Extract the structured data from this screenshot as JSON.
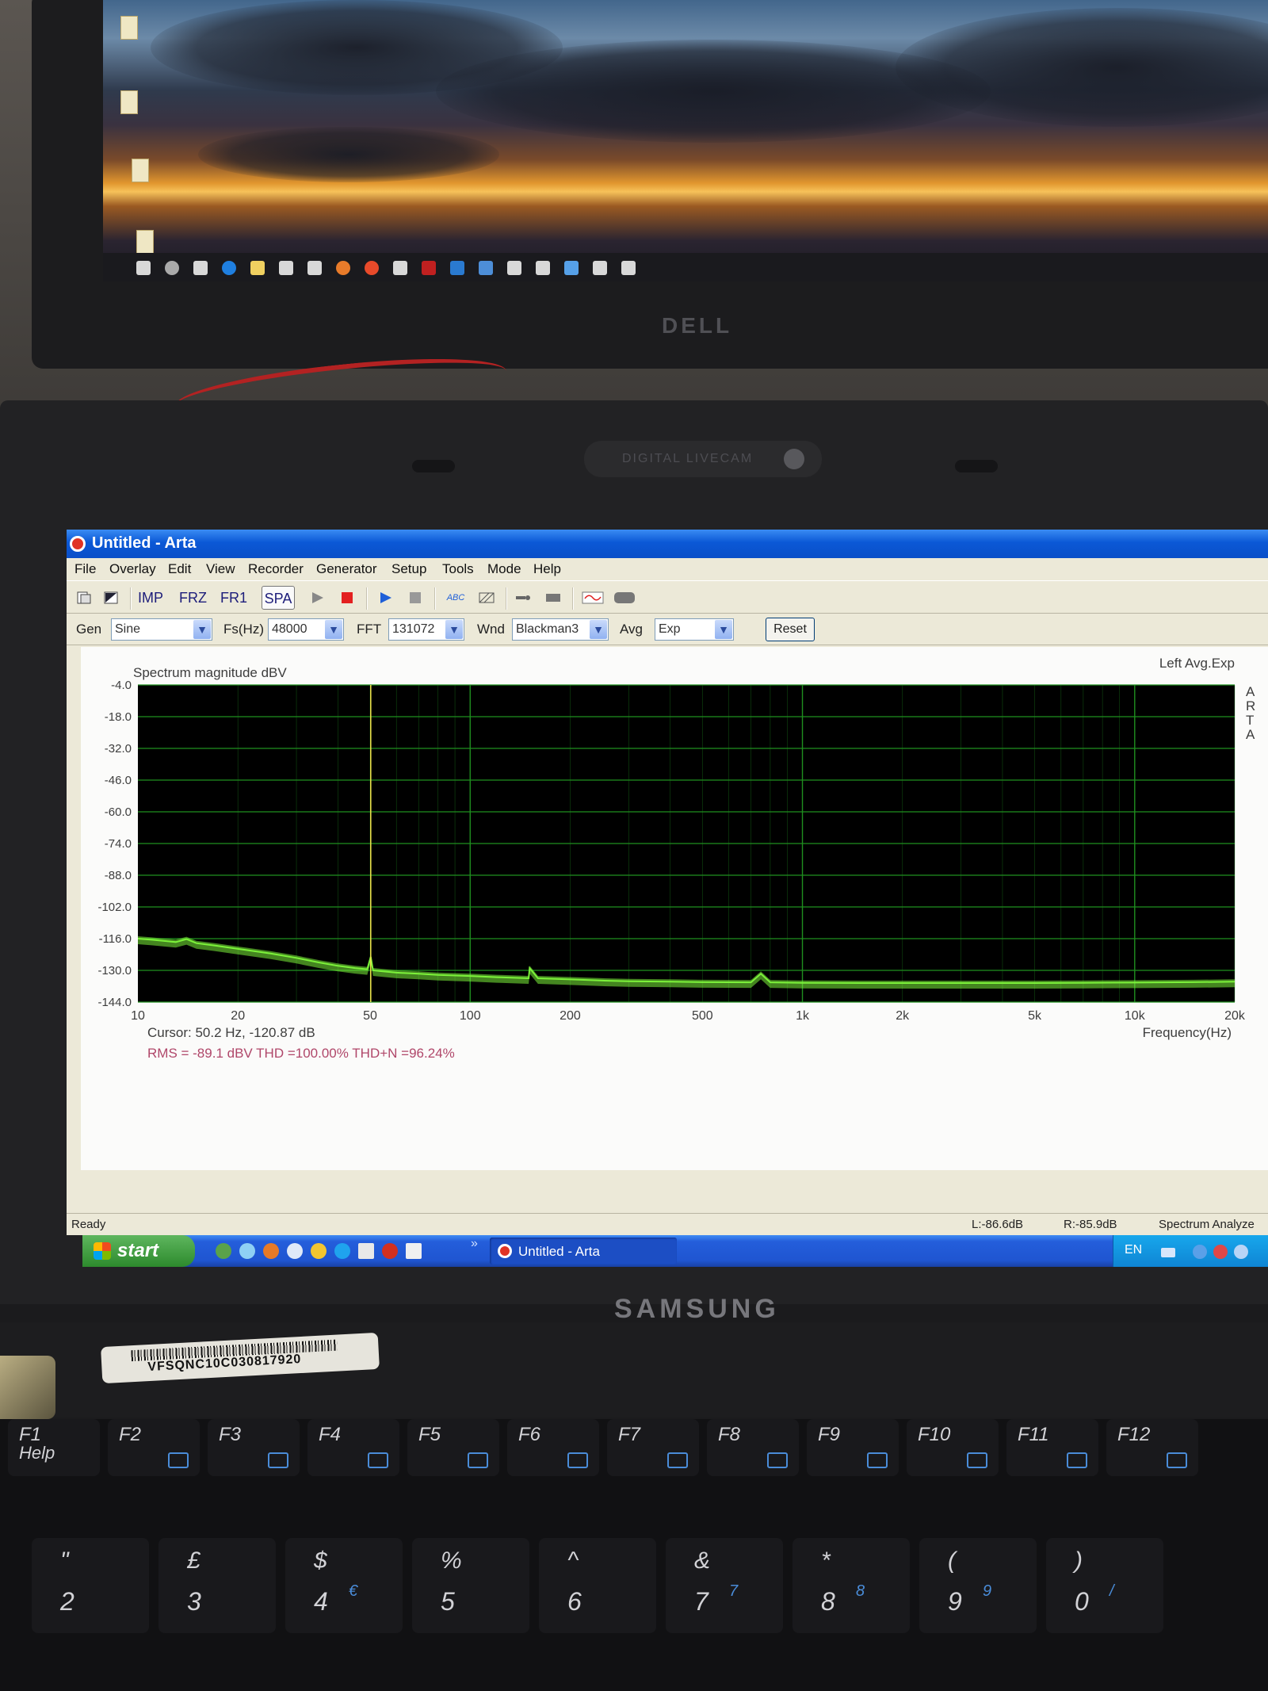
{
  "window": {
    "title": "Untitled - Arta"
  },
  "menu": [
    "File",
    "Overlay",
    "Edit",
    "View",
    "Recorder",
    "Generator",
    "Setup",
    "Tools",
    "Mode",
    "Help"
  ],
  "toolbar": {
    "imp": "IMP",
    "frz": "FRZ",
    "fr1": "FR1",
    "spa": "SPA",
    "abc": "ABC",
    "icons": [
      "new-document-icon",
      "open-icon",
      "play-icon",
      "stop-icon",
      "play-blue-icon",
      "stop-gray-icon",
      "abc-icon",
      "hatch-icon",
      "probe-icon",
      "rectangle-icon",
      "wave-icon",
      "ellipse-icon"
    ]
  },
  "controls": {
    "gen_label": "Gen",
    "gen_value": "Sine",
    "fs_label": "Fs(Hz)",
    "fs_value": "48000",
    "fft_label": "FFT",
    "fft_value": "131072",
    "wnd_label": "Wnd",
    "wnd_value": "Blackman3",
    "avg_label": "Avg",
    "avg_value": "Exp",
    "reset_label": "Reset"
  },
  "plot": {
    "title": "Spectrum magnitude dBV",
    "corner_label": "Left Avg.Exp",
    "side_label": [
      "A",
      "R",
      "T",
      "A"
    ],
    "xlabel": "Frequency(Hz)",
    "cursor_text": "Cursor:  50.2 Hz, -120.87 dB",
    "measure_text": "RMS = -89.1 dBV   THD =100.00%   THD+N =96.24%"
  },
  "chart_data": {
    "type": "line",
    "title": "Spectrum magnitude dBV",
    "xlabel": "Frequency(Hz)",
    "ylabel": "",
    "x_scale": "log",
    "xlim": [
      10,
      20000
    ],
    "ylim": [
      -144.0,
      -4.0
    ],
    "x_ticks": [
      "10",
      "20",
      "50",
      "100",
      "200",
      "500",
      "1k",
      "2k",
      "5k",
      "10k",
      "20k"
    ],
    "x_tick_values": [
      10,
      20,
      50,
      100,
      200,
      500,
      1000,
      2000,
      5000,
      10000,
      20000
    ],
    "y_ticks": [
      "-4.0",
      "-18.0",
      "-32.0",
      "-46.0",
      "-60.0",
      "-74.0",
      "-88.0",
      "-102.0",
      "-116.0",
      "-130.0",
      "-144.0"
    ],
    "y_tick_values": [
      -4,
      -18,
      -32,
      -46,
      -60,
      -74,
      -88,
      -102,
      -116,
      -130,
      -144
    ],
    "grid": true,
    "cursor": {
      "x": 50.2,
      "y": -120.87
    },
    "series": [
      {
        "x": [
          10,
          11,
          12,
          13,
          14,
          15,
          17,
          20,
          25,
          30,
          35,
          40,
          45,
          49,
          50.2,
          51,
          55,
          60,
          70,
          80,
          100,
          120,
          150,
          151,
          160,
          200,
          250,
          300,
          400,
          500,
          700,
          750,
          800,
          1000,
          1500,
          2000,
          3000,
          5000,
          7000,
          10000,
          15000,
          20000
        ],
        "y": [
          -116,
          -116.5,
          -117,
          -117.5,
          -116.2,
          -118,
          -119,
          -120.5,
          -122.5,
          -124.5,
          -126.5,
          -128,
          -129,
          -129.5,
          -124,
          -130,
          -130.5,
          -131,
          -131.5,
          -132,
          -132.5,
          -133,
          -133.5,
          -129,
          -133.5,
          -134,
          -134.5,
          -134.8,
          -135,
          -135.2,
          -135.3,
          -131.5,
          -135.3,
          -135.5,
          -135.6,
          -135.6,
          -135.6,
          -135.6,
          -135.5,
          -135.4,
          -135.2,
          -135
        ]
      }
    ]
  },
  "status": {
    "ready": "Ready",
    "left_level": "L:-86.6dB",
    "right_level": "R:-85.9dB",
    "mode": "Spectrum Analyze"
  },
  "taskbar": {
    "start": "start",
    "task": "Untitled - Arta",
    "lang": "EN",
    "expand": "»"
  },
  "hardware": {
    "monitor_brand": "DELL",
    "webcam": "DIGITAL LIVECAM",
    "laptop_brand": "SAMSUNG",
    "serial": "VFSQNC10C030817920",
    "fkeys": [
      {
        "top": "F1",
        "bottom": "Help"
      },
      {
        "top": "F2",
        "bottom": ""
      },
      {
        "top": "F3",
        "bottom": ""
      },
      {
        "top": "F4",
        "bottom": ""
      },
      {
        "top": "F5",
        "bottom": ""
      },
      {
        "top": "F6",
        "bottom": ""
      },
      {
        "top": "F7",
        "bottom": ""
      },
      {
        "top": "F8",
        "bottom": ""
      },
      {
        "top": "F9",
        "bottom": ""
      },
      {
        "top": "F10",
        "bottom": ""
      },
      {
        "top": "F11",
        "bottom": ""
      },
      {
        "top": "F12",
        "bottom": ""
      }
    ],
    "numkeys": [
      {
        "top": "\"",
        "bottom": "2",
        "alt": ""
      },
      {
        "top": "£",
        "bottom": "3",
        "alt": ""
      },
      {
        "top": "$",
        "bottom": "4",
        "alt": "€"
      },
      {
        "top": "%",
        "bottom": "5",
        "alt": ""
      },
      {
        "top": "^",
        "bottom": "6",
        "alt": ""
      },
      {
        "top": "&",
        "bottom": "7",
        "alt": "7"
      },
      {
        "top": "*",
        "bottom": "8",
        "alt": "8"
      },
      {
        "top": "(",
        "bottom": "9",
        "alt": "9"
      },
      {
        "top": ")",
        "bottom": "0",
        "alt": "/"
      }
    ]
  },
  "colors": {
    "plot_bg": "#000000",
    "grid": "#1f8f1f",
    "trace": "#7cf23a",
    "cursor": "#e8e04a",
    "axis_text": "#3d3d3d",
    "measure_text": "#b0476a",
    "xp_blue": "#0b58d6"
  }
}
